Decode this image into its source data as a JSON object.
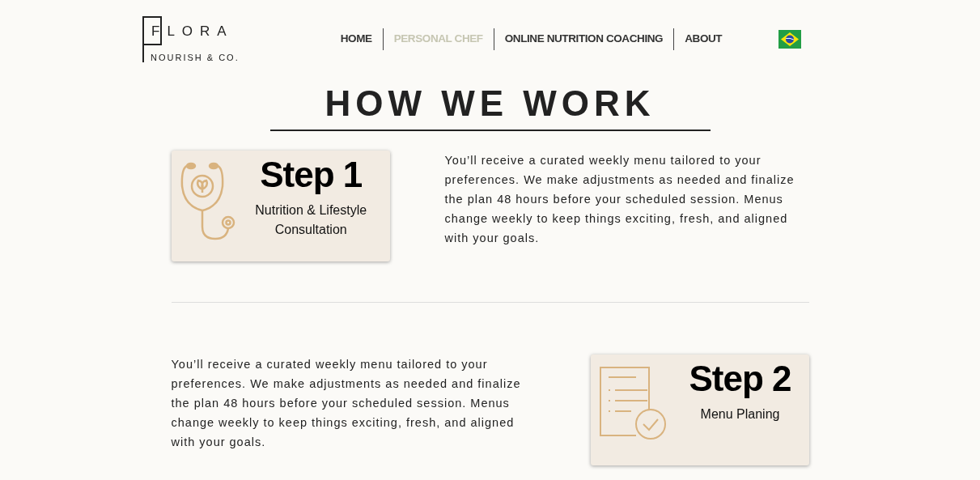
{
  "logo": {
    "name": "FLORA",
    "tagline": "NOURISH & CO."
  },
  "nav": [
    {
      "label": "HOME",
      "selected": false
    },
    {
      "label": "PERSONAL CHEF",
      "selected": true
    },
    {
      "label": "ONLINE NUTRITION COACHING",
      "selected": false
    },
    {
      "label": "ABOUT",
      "selected": false
    }
  ],
  "heading": "HOW WE WORK",
  "steps": [
    {
      "kind": "stethoscope",
      "title": "Step 1",
      "subtitle": "Nutrition & Lifestyle Consultation",
      "text": "You’ll receive a curated weekly menu tailored to your preferences. We make adjustments as needed and finalize the plan 48 hours before your scheduled session. Menus change weekly to keep things exciting, fresh, and aligned with your goals."
    },
    {
      "kind": "checklist",
      "title": "Step 2",
      "subtitle": "Menu Planing",
      "text": "You’ll receive a curated weekly menu tailored to your preferences. We make adjustments as needed and finalize the plan 48 hours before your scheduled session. Menus change weekly to keep things exciting, fresh, and aligned with your goals."
    }
  ]
}
